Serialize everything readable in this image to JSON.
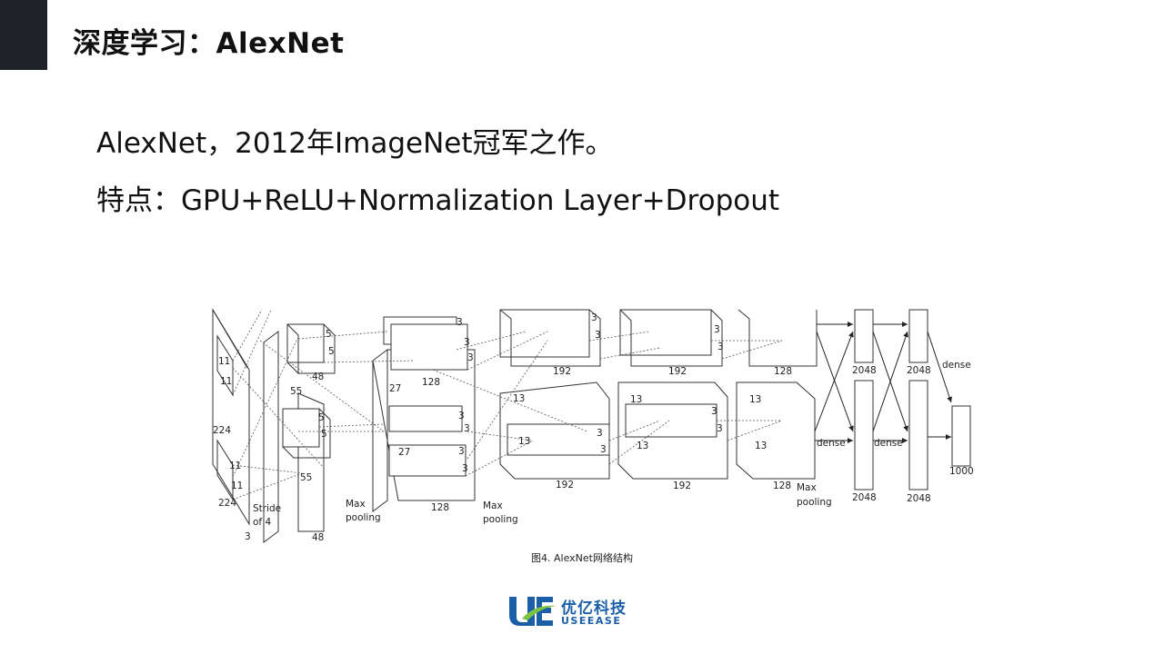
{
  "slide": {
    "title": "深度学习：AlexNet",
    "bullets": [
      "AlexNet，2012年ImageNet冠军之作。",
      "特点：GPU+ReLU+Normalization Layer+Dropout"
    ]
  },
  "figure": {
    "caption": "图4. AlexNet网络结构",
    "labels": {
      "input_k1": "11",
      "input_k2": "11",
      "input_224a": "224",
      "input_224b": "224",
      "input_3": "3",
      "input_k3": "11",
      "input_k4": "11",
      "stride_1": "Stride",
      "stride_2": "of 4",
      "c1_5a": "5",
      "c1_5b": "5",
      "c1_48a": "48",
      "c1_55a": "55",
      "c1_5c": "5",
      "c1_5d": "5",
      "c1_55b": "55",
      "c1_48b": "48",
      "pool1_1": "Max",
      "pool1_2": "pooling",
      "c2_3a": "3",
      "c2_3b": "3",
      "c2_3c": "3",
      "c2_128a": "128",
      "c2_27a": "27",
      "c2_3d": "3",
      "c2_3e": "3",
      "c2_27b": "27",
      "c2_3f": "3",
      "c2_3g": "3",
      "c2_128b": "128",
      "pool2_1": "Max",
      "pool2_2": "pooling",
      "c3_3a": "3",
      "c3_3b": "3",
      "c3_192a": "192",
      "c3_13a": "13",
      "c3_3c": "3",
      "c3_13b": "13",
      "c3_3d": "3",
      "c3_192b": "192",
      "c4_3a": "3",
      "c4_3b": "3",
      "c4_192a": "192",
      "c4_13a": "13",
      "c4_3c": "3",
      "c4_3d": "3",
      "c4_13b": "13",
      "c4_192b": "192",
      "c5_128a": "128",
      "c5_13a": "13",
      "c5_13b": "13",
      "c5_128b": "128",
      "pool3_1": "Max",
      "pool3_2": "pooling",
      "fc_2048a": "2048",
      "fc_2048b": "2048",
      "fc_2048c": "2048",
      "fc_2048d": "2048",
      "dense_a": "dense",
      "dense_b": "dense",
      "dense_c": "dense",
      "out_1000": "1000"
    }
  },
  "logo": {
    "name_cn": "优亿科技",
    "name_en": "USEEASE",
    "colors": {
      "blue": "#1b5fa8",
      "green": "#7cc242"
    }
  },
  "colors": {
    "accent_bar": "#1f2227"
  }
}
